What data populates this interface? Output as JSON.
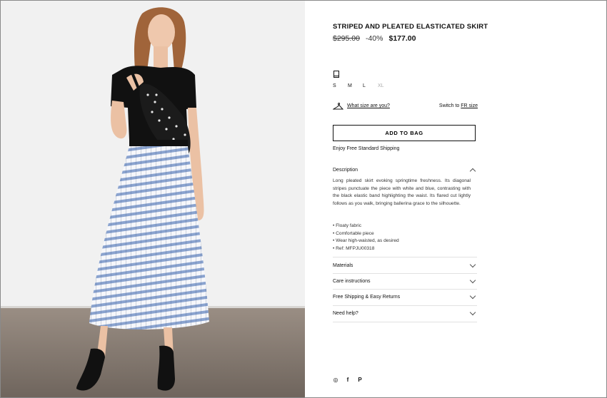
{
  "product": {
    "title": "STRIPED AND PLEATED ELASTICATED SKIRT",
    "price_original": "$295.00",
    "discount": "-40%",
    "price_sale": "$177.00"
  },
  "sizes": {
    "options": [
      "S",
      "M",
      "L",
      "XL"
    ],
    "unavailable": [
      "XL"
    ]
  },
  "size_help": {
    "link": "What size are you?",
    "switch_prefix": "Switch to",
    "switch_link": "FR size"
  },
  "cart": {
    "add_label": "ADD TO BAG",
    "shipping_note": "Enjoy Free Standard Shipping"
  },
  "accordion": {
    "description": {
      "label": "Description",
      "text": "Long pleated skirt evoking springtime freshness. Its diagonal stripes punctuate the piece with white and blue, contrasting with the black elastic band highlighting the waist. Its flared cut lightly follows as you walk, bringing ballerina grace to the silhouette.",
      "bullets": [
        "Floaty fabric",
        "Comfortable piece",
        "Wear high-waisted, as desired",
        "Ref: MFPJU00318"
      ]
    },
    "materials": "Materials",
    "care": "Care instructions",
    "returns": "Free Shipping & Easy Returns",
    "help": "Need help?"
  },
  "social": {
    "icons": [
      "instagram-icon",
      "facebook-icon",
      "pinterest-icon"
    ],
    "glyphs": [
      "◎",
      "f",
      "P"
    ]
  },
  "colors": {
    "skirt_blue": "#8aa3cf",
    "background": "#f2f2f2",
    "floor": "#7a6f66"
  }
}
